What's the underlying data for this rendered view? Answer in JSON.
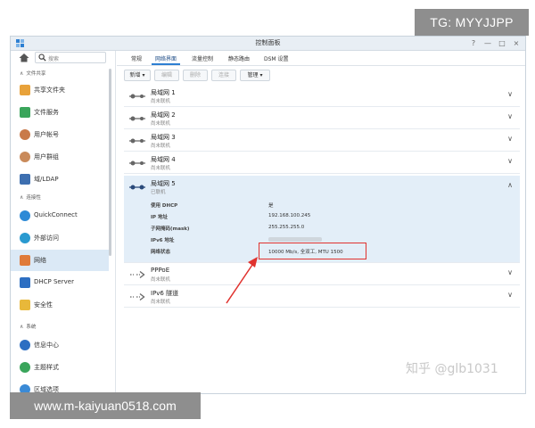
{
  "watermarks": {
    "top": "TG: MYYJJPP",
    "bottom": "www.m-kaiyuan0518.com",
    "zhihu": "知乎 @glb1031"
  },
  "window": {
    "title": "控制面板",
    "controls": [
      "?",
      "—",
      "□",
      "×"
    ]
  },
  "sidebar": {
    "search_placeholder": "搜索",
    "sections": [
      {
        "label": "文件共享",
        "items": [
          "共享文件夹",
          "文件服务",
          "用户帐号",
          "用户群组",
          "域/LDAP"
        ]
      },
      {
        "label": "连接性",
        "items": [
          "QuickConnect",
          "外部访问",
          "网络",
          "DHCP Server",
          "安全性"
        ]
      },
      {
        "label": "系统",
        "items": [
          "信息中心",
          "主题样式",
          "区域选项"
        ]
      }
    ],
    "active_item": "网络"
  },
  "tabs": [
    "常规",
    "网络界面",
    "流量控制",
    "静态路由",
    "DSM 设置"
  ],
  "active_tab": "网络界面",
  "toolbar": {
    "new": "新增 ▾",
    "edit": "编辑",
    "delete": "删除",
    "connect": "连接",
    "manage": "管理 ▾"
  },
  "interfaces": [
    {
      "name": "局域网 1",
      "status": "尚未联机"
    },
    {
      "name": "局域网 2",
      "status": "尚未联机"
    },
    {
      "name": "局域网 3",
      "status": "尚未联机"
    },
    {
      "name": "局域网 4",
      "status": "尚未联机"
    },
    {
      "name": "局域网 5",
      "status": "已联机"
    },
    {
      "name": "PPPoE",
      "status": "尚未联机"
    },
    {
      "name": "IPv6 隧道",
      "status": "尚未联机"
    }
  ],
  "expanded_details": {
    "dhcp_key": "使用 DHCP",
    "dhcp_val": "是",
    "ip_key": "IP 地址",
    "ip_val": "192.168.100.245",
    "mask_key": "子网掩码(mask)",
    "mask_val": "255.255.255.0",
    "ipv6_key": "IPv6 地址",
    "net_key": "网络状态",
    "net_val": "10000 Mb/s, 全双工, MTU 1500"
  },
  "colors": {
    "accent": "#2d7fd2",
    "highlight": "#e0322e",
    "selected_bg": "#dbe9f6"
  }
}
